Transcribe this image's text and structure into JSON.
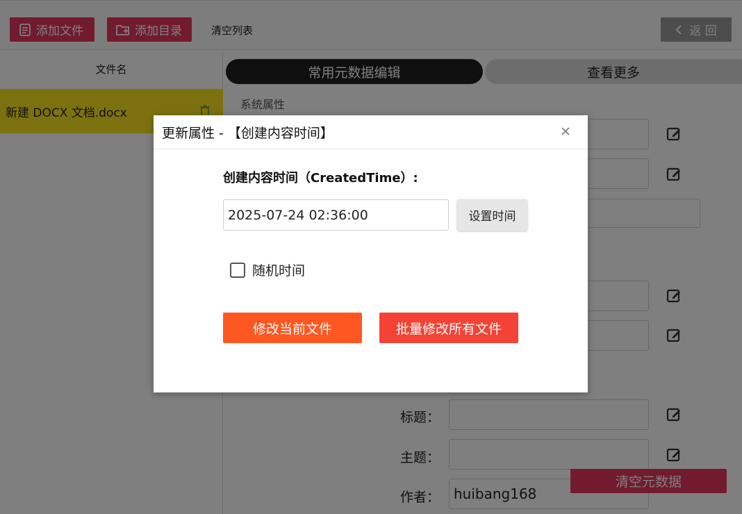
{
  "toolbar": {
    "add_file": "添加文件",
    "add_dir": "添加目录",
    "clear_list": "清空列表",
    "back": "返 回"
  },
  "file_list": {
    "header": "文件名",
    "files": [
      {
        "name": "新建 DOCX 文档.docx"
      }
    ]
  },
  "tabs": {
    "common": "常用元数据编辑",
    "more": "查看更多"
  },
  "panel": {
    "system_section": "系统属性",
    "fields": [
      {
        "label": "标题：",
        "value": ""
      },
      {
        "label": "主题：",
        "value": ""
      },
      {
        "label": "作者：",
        "value": "huibang168"
      }
    ],
    "clear_meta": "清空元数据"
  },
  "dialog": {
    "title": "更新属性 - 【创建内容时间】",
    "field_label": "创建内容时间（CreatedTime）:",
    "datetime_value": "2025-07-24 02:36:00",
    "set_time": "设置时间",
    "random_time": "随机时间",
    "random_checked": false,
    "modify_current": "修改当前文件",
    "modify_all": "批量修改所有文件"
  },
  "colors": {
    "primary": "#e4375f",
    "orange": "#ff5722",
    "red": "#f44336",
    "highlight": "#fbe31f"
  }
}
